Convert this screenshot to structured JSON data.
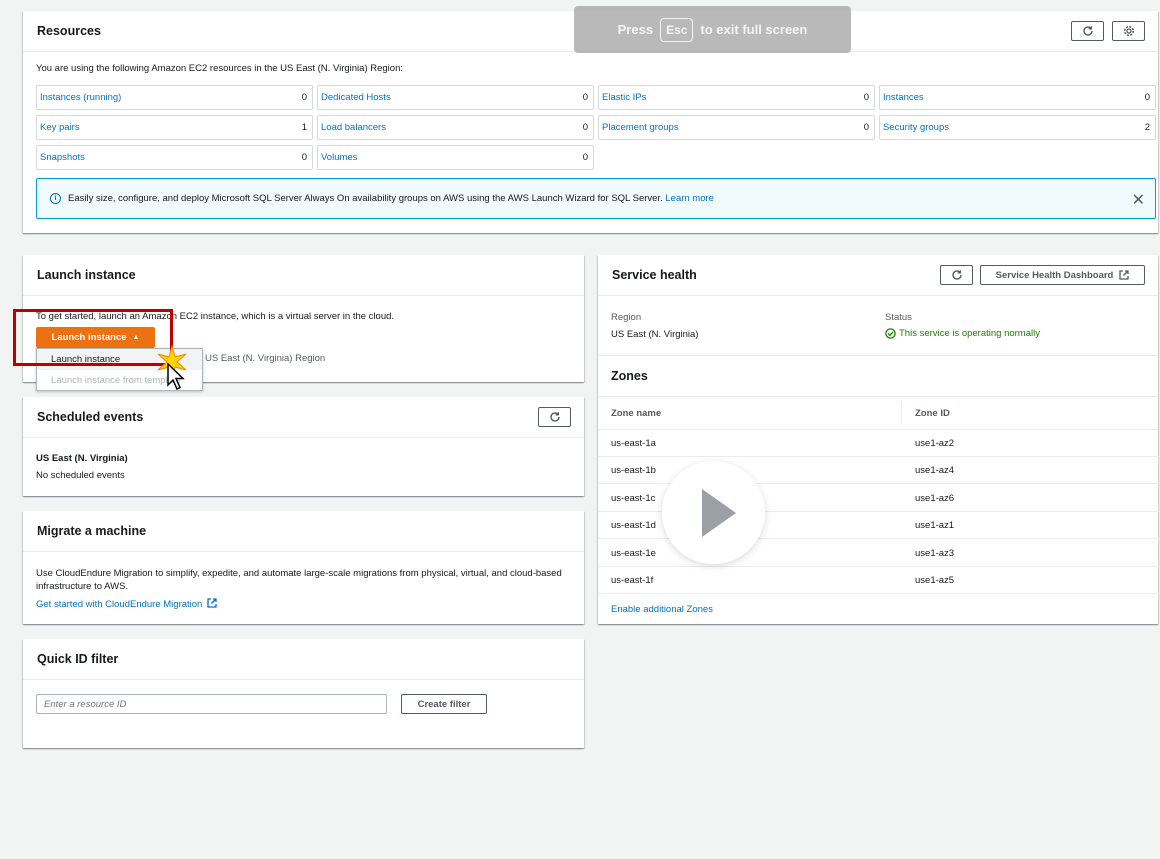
{
  "overlay": {
    "press": "Press",
    "key": "Esc",
    "exit": "to exit full screen"
  },
  "resources": {
    "title": "Resources",
    "intro": "You are using the following Amazon EC2 resources in the US East (N. Virginia) Region:",
    "items": [
      {
        "label": "Instances (running)",
        "count": "0"
      },
      {
        "label": "Dedicated Hosts",
        "count": "0"
      },
      {
        "label": "Elastic IPs",
        "count": "0"
      },
      {
        "label": "Instances",
        "count": "0"
      },
      {
        "label": "Key pairs",
        "count": "1"
      },
      {
        "label": "Load balancers",
        "count": "0"
      },
      {
        "label": "Placement groups",
        "count": "0"
      },
      {
        "label": "Security groups",
        "count": "2"
      },
      {
        "label": "Snapshots",
        "count": "0"
      },
      {
        "label": "Volumes",
        "count": "0"
      }
    ],
    "info_text": "Easily size, configure, and deploy Microsoft SQL Server Always On availability groups on AWS using the AWS Launch Wizard for SQL Server.",
    "info_link": "Learn more"
  },
  "launch": {
    "title": "Launch instance",
    "intro": "To get started, launch an Amazon EC2 instance, which is a virtual server in the cloud.",
    "button": "Launch instance",
    "menu": [
      "Launch instance",
      "Launch instance from template"
    ],
    "region_note": "US East (N. Virginia) Region"
  },
  "scheduled": {
    "title": "Scheduled events",
    "region": "US East (N. Virginia)",
    "empty": "No scheduled events"
  },
  "migrate": {
    "title": "Migrate a machine",
    "text": "Use CloudEndure Migration to simplify, expedite, and automate large-scale migrations from physical, virtual, and cloud-based infrastructure to AWS.",
    "link": "Get started with CloudEndure Migration"
  },
  "quick": {
    "title": "Quick ID filter",
    "placeholder": "Enter a resource ID",
    "button": "Create filter"
  },
  "health": {
    "title": "Service health",
    "dashboard_button": "Service Health Dashboard",
    "region_label": "Region",
    "region_value": "US East (N. Virginia)",
    "status_label": "Status",
    "status_value": "This service is operating normally",
    "status_color": "#1d8102"
  },
  "zones": {
    "title": "Zones",
    "col_name": "Zone name",
    "col_id": "Zone ID",
    "rows": [
      {
        "name": "us-east-1a",
        "id": "use1-az2"
      },
      {
        "name": "us-east-1b",
        "id": "use1-az4"
      },
      {
        "name": "us-east-1c",
        "id": "use1-az6"
      },
      {
        "name": "us-east-1d",
        "id": "use1-az1"
      },
      {
        "name": "us-east-1e",
        "id": "use1-az3"
      },
      {
        "name": "us-east-1f",
        "id": "use1-az5"
      }
    ],
    "link": "Enable additional Zones"
  },
  "colors": {
    "accent": "#ec7211",
    "link": "#0073bb",
    "highlight": "#c00000"
  }
}
